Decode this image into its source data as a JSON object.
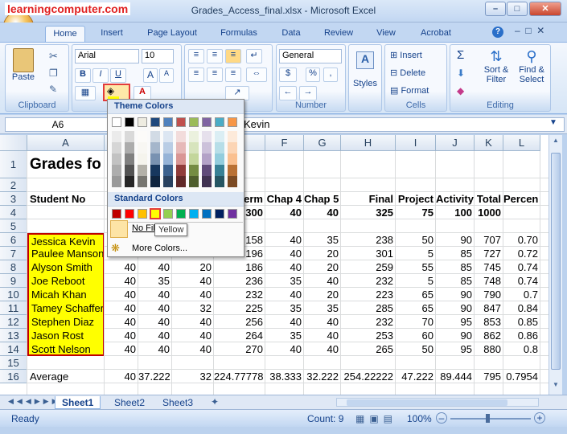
{
  "watermark": "learningcomputer.com",
  "window": {
    "title": "Grades_Access_final.xlsx - Microsoft Excel"
  },
  "tabs": [
    "Home",
    "Insert",
    "Page Layout",
    "Formulas",
    "Data",
    "Review",
    "View",
    "Acrobat"
  ],
  "ribbon": {
    "paste": "Paste",
    "clipboard": "Clipboard",
    "font_name": "Arial",
    "font_size": "10",
    "bold": "B",
    "italic": "I",
    "underline": "U",
    "grow": "A",
    "shrink": "A",
    "font_color": "A",
    "number_format": "General",
    "currency": "$",
    "percent": "%",
    "comma": ",",
    "number": "Number",
    "styles": "Styles",
    "insert": "Insert",
    "delete": "Delete",
    "format": "Format",
    "cells": "Cells",
    "sum": "Σ",
    "sort_filter": [
      "Sort &",
      "Filter"
    ],
    "find_select": [
      "Find &",
      "Select"
    ],
    "editing": "Editing"
  },
  "formula_bar": {
    "name_box": "A6",
    "value": "Kevin"
  },
  "columns": [
    "A",
    "B",
    "C",
    "D",
    "E",
    "F",
    "G",
    "H",
    "I",
    "J",
    "K",
    "L"
  ],
  "rows": [
    {
      "n": "1",
      "c": [
        "Grades fo",
        "",
        "",
        "",
        "",
        "",
        "",
        "",
        "",
        "",
        "",
        ""
      ]
    },
    {
      "n": "2",
      "c": [
        "",
        "",
        "",
        "",
        "",
        "",
        "",
        "",
        "",
        "",
        "",
        ""
      ]
    },
    {
      "n": "3",
      "c": [
        "Student No",
        "",
        "",
        "",
        "erm",
        "Chap 4",
        "Chap 5",
        "Final",
        "Project",
        "Activity",
        "Total",
        "Percen"
      ]
    },
    {
      "n": "4",
      "c": [
        "",
        "",
        "",
        "",
        "300",
        "40",
        "40",
        "325",
        "75",
        "100",
        "1000",
        ""
      ]
    },
    {
      "n": "5",
      "c": [
        "",
        "",
        "",
        "",
        "",
        "",
        "",
        "",
        "",
        "",
        "",
        ""
      ]
    },
    {
      "n": "6",
      "c": [
        "Jessica Kevin",
        "",
        "",
        "",
        "158",
        "40",
        "35",
        "238",
        "50",
        "90",
        "707",
        "0.70"
      ]
    },
    {
      "n": "7",
      "c": [
        "Paulee Manson",
        "",
        "",
        "0",
        "196",
        "40",
        "20",
        "301",
        "5",
        "85",
        "727",
        "0.72"
      ]
    },
    {
      "n": "8",
      "c": [
        "Alyson Smith",
        "40",
        "40",
        "20",
        "186",
        "40",
        "20",
        "259",
        "55",
        "85",
        "745",
        "0.74"
      ]
    },
    {
      "n": "9",
      "c": [
        "Joe Reboot",
        "40",
        "35",
        "40",
        "236",
        "35",
        "40",
        "232",
        "5",
        "85",
        "748",
        "0.74"
      ]
    },
    {
      "n": "10",
      "c": [
        "Micah Khan",
        "40",
        "40",
        "40",
        "232",
        "40",
        "20",
        "223",
        "65",
        "90",
        "790",
        "0.7"
      ]
    },
    {
      "n": "11",
      "c": [
        "Tamey Schaffer",
        "40",
        "40",
        "32",
        "225",
        "35",
        "35",
        "285",
        "65",
        "90",
        "847",
        "0.84"
      ]
    },
    {
      "n": "12",
      "c": [
        "Stephen Diaz",
        "40",
        "40",
        "40",
        "256",
        "40",
        "40",
        "232",
        "70",
        "95",
        "853",
        "0.85"
      ]
    },
    {
      "n": "13",
      "c": [
        "Jason Rost",
        "40",
        "40",
        "40",
        "264",
        "35",
        "40",
        "253",
        "60",
        "90",
        "862",
        "0.86"
      ]
    },
    {
      "n": "14",
      "c": [
        "Scott Nelson",
        "40",
        "40",
        "40",
        "270",
        "40",
        "40",
        "265",
        "50",
        "95",
        "880",
        "0.8"
      ]
    },
    {
      "n": "15",
      "c": [
        "",
        "",
        "",
        "",
        "",
        "",
        "",
        "",
        "",
        "",
        "",
        ""
      ]
    },
    {
      "n": "16",
      "c": [
        "Average",
        "40",
        "37.222",
        "32",
        "224.77778",
        "38.333",
        "32.222",
        "254.22222",
        "47.222",
        "89.444",
        "795",
        "0.7954"
      ]
    }
  ],
  "title_cell": "Grades fo",
  "sheets": [
    "Sheet1",
    "Sheet2",
    "Sheet3"
  ],
  "status": {
    "ready": "Ready",
    "count": "Count: 9",
    "zoom": "100%"
  },
  "fill_menu": {
    "theme_header": "Theme Colors",
    "standard_header": "Standard Colors",
    "no_fill": "No Fill",
    "more_colors": "More Colors...",
    "tooltip": "Yellow",
    "theme_top": [
      "#ffffff",
      "#000000",
      "#eeece1",
      "#1f497d",
      "#4f81bd",
      "#c0504d",
      "#9bbb59",
      "#8064a2",
      "#4bacc6",
      "#f79646"
    ],
    "standard": [
      "#c00000",
      "#ff0000",
      "#ffc000",
      "#ffff00",
      "#92d050",
      "#00b050",
      "#00b0f0",
      "#0070c0",
      "#002060",
      "#7030a0"
    ]
  },
  "colors": {
    "selection_fill": "#ffff00",
    "selection_border": "#c00000"
  }
}
